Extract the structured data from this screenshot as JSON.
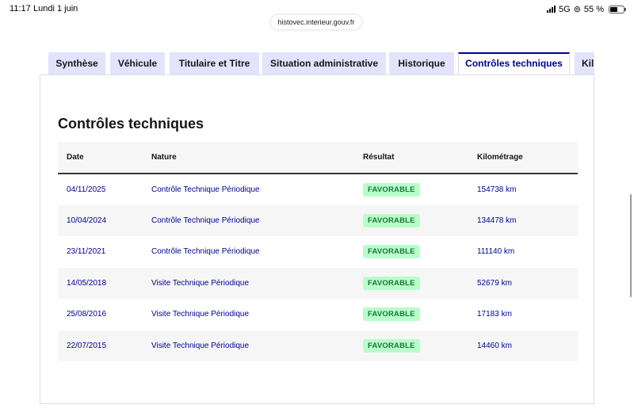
{
  "status_bar": {
    "time": "11:17",
    "date": "Lundi 1 juin",
    "network": "5G",
    "battery_percent": "55 %",
    "battery_level": 0.55
  },
  "browser": {
    "url": "histovec.interieur.gouv.fr"
  },
  "tabs": [
    {
      "label": "Synthèse",
      "active": false
    },
    {
      "label": "Véhicule",
      "active": false
    },
    {
      "label": "Titulaire et Titre",
      "active": false
    },
    {
      "label": "Situation administrative",
      "active": false
    },
    {
      "label": "Historique",
      "active": false
    },
    {
      "label": "Contrôles techniques",
      "active": true
    },
    {
      "label": "Kil",
      "active": false
    }
  ],
  "section": {
    "title": "Contrôles techniques"
  },
  "table": {
    "headers": [
      "Date",
      "Nature",
      "Résultat",
      "Kilométrage"
    ],
    "rows": [
      {
        "date": "04/11/2025",
        "nature": "Contrôle Technique Périodique",
        "result": "FAVORABLE",
        "km": "154738 km"
      },
      {
        "date": "10/04/2024",
        "nature": "Contrôle Technique Périodique",
        "result": "FAVORABLE",
        "km": "134478 km"
      },
      {
        "date": "23/11/2021",
        "nature": "Contrôle Technique Périodique",
        "result": "FAVORABLE",
        "km": "111140 km"
      },
      {
        "date": "14/05/2018",
        "nature": "Visite Technique Périodique",
        "result": "FAVORABLE",
        "km": "52679 km"
      },
      {
        "date": "25/08/2016",
        "nature": "Visite Technique Périodique",
        "result": "FAVORABLE",
        "km": "17183 km"
      },
      {
        "date": "22/07/2015",
        "nature": "Visite Technique Périodique",
        "result": "FAVORABLE",
        "km": "14460 km"
      }
    ]
  },
  "colors": {
    "primary_blue": "#000091",
    "tab_bg": "#e3e3fd",
    "badge_bg": "#b8fec9",
    "badge_text": "#18753c",
    "row_alt": "#f6f6f6"
  }
}
